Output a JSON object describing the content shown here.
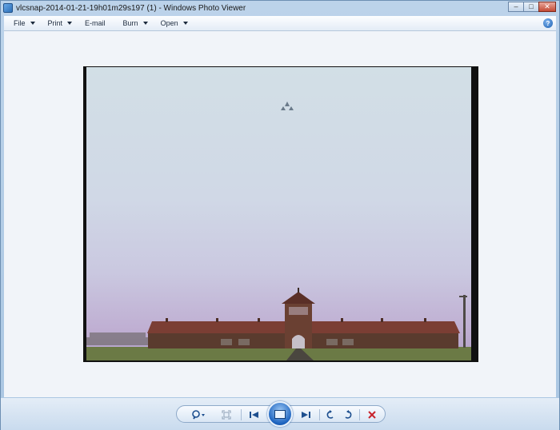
{
  "window": {
    "title": "vlcsnap-2014-01-21-19h01m29s197 (1) - Windows Photo Viewer",
    "controls": {
      "minimize": "–",
      "maximize": "□",
      "close": "✕"
    }
  },
  "menu": {
    "items": [
      {
        "label": "File",
        "has_dropdown": true
      },
      {
        "label": "Print",
        "has_dropdown": true
      },
      {
        "label": "E-mail",
        "has_dropdown": false
      },
      {
        "label": "Burn",
        "has_dropdown": true
      },
      {
        "label": "Open",
        "has_dropdown": true
      }
    ],
    "help_label": "?"
  },
  "toolbar": {
    "zoom_icon": "magnifier-icon",
    "actual_size_icon": "actual-size-icon",
    "previous_icon": "previous-icon",
    "slideshow_icon": "slideshow-icon",
    "next_icon": "next-icon",
    "rotate_ccw_icon": "rotate-counterclockwise-icon",
    "rotate_cw_icon": "rotate-clockwise-icon",
    "delete_icon": "delete-icon"
  },
  "colors": {
    "accent_blue": "#1d64c0",
    "delete_red": "#c8242c",
    "viewer_bg": "#f1f4f9"
  }
}
